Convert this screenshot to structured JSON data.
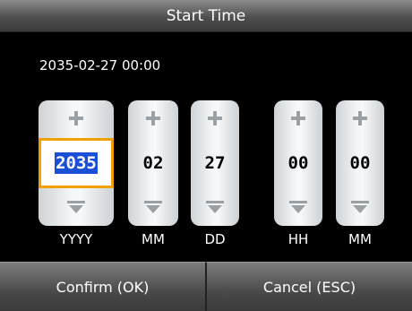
{
  "title": "Start Time",
  "datetime": "2035-02-27 00:00",
  "fields": [
    {
      "label": "YYYY",
      "value": "2035",
      "selected": true
    },
    {
      "label": "MM",
      "value": "02",
      "selected": false
    },
    {
      "label": "DD",
      "value": "27",
      "selected": false
    },
    {
      "label": "HH",
      "value": "00",
      "selected": false
    },
    {
      "label": "MM",
      "value": "00",
      "selected": false
    }
  ],
  "buttons": {
    "confirm": "Confirm (OK)",
    "cancel": "Cancel (ESC)"
  },
  "colors": {
    "selection_border": "#f0a000",
    "selection_fill": "#1a4fd6"
  },
  "icons": {
    "increment": "plus-icon",
    "decrement": "down-triangle-icon"
  }
}
